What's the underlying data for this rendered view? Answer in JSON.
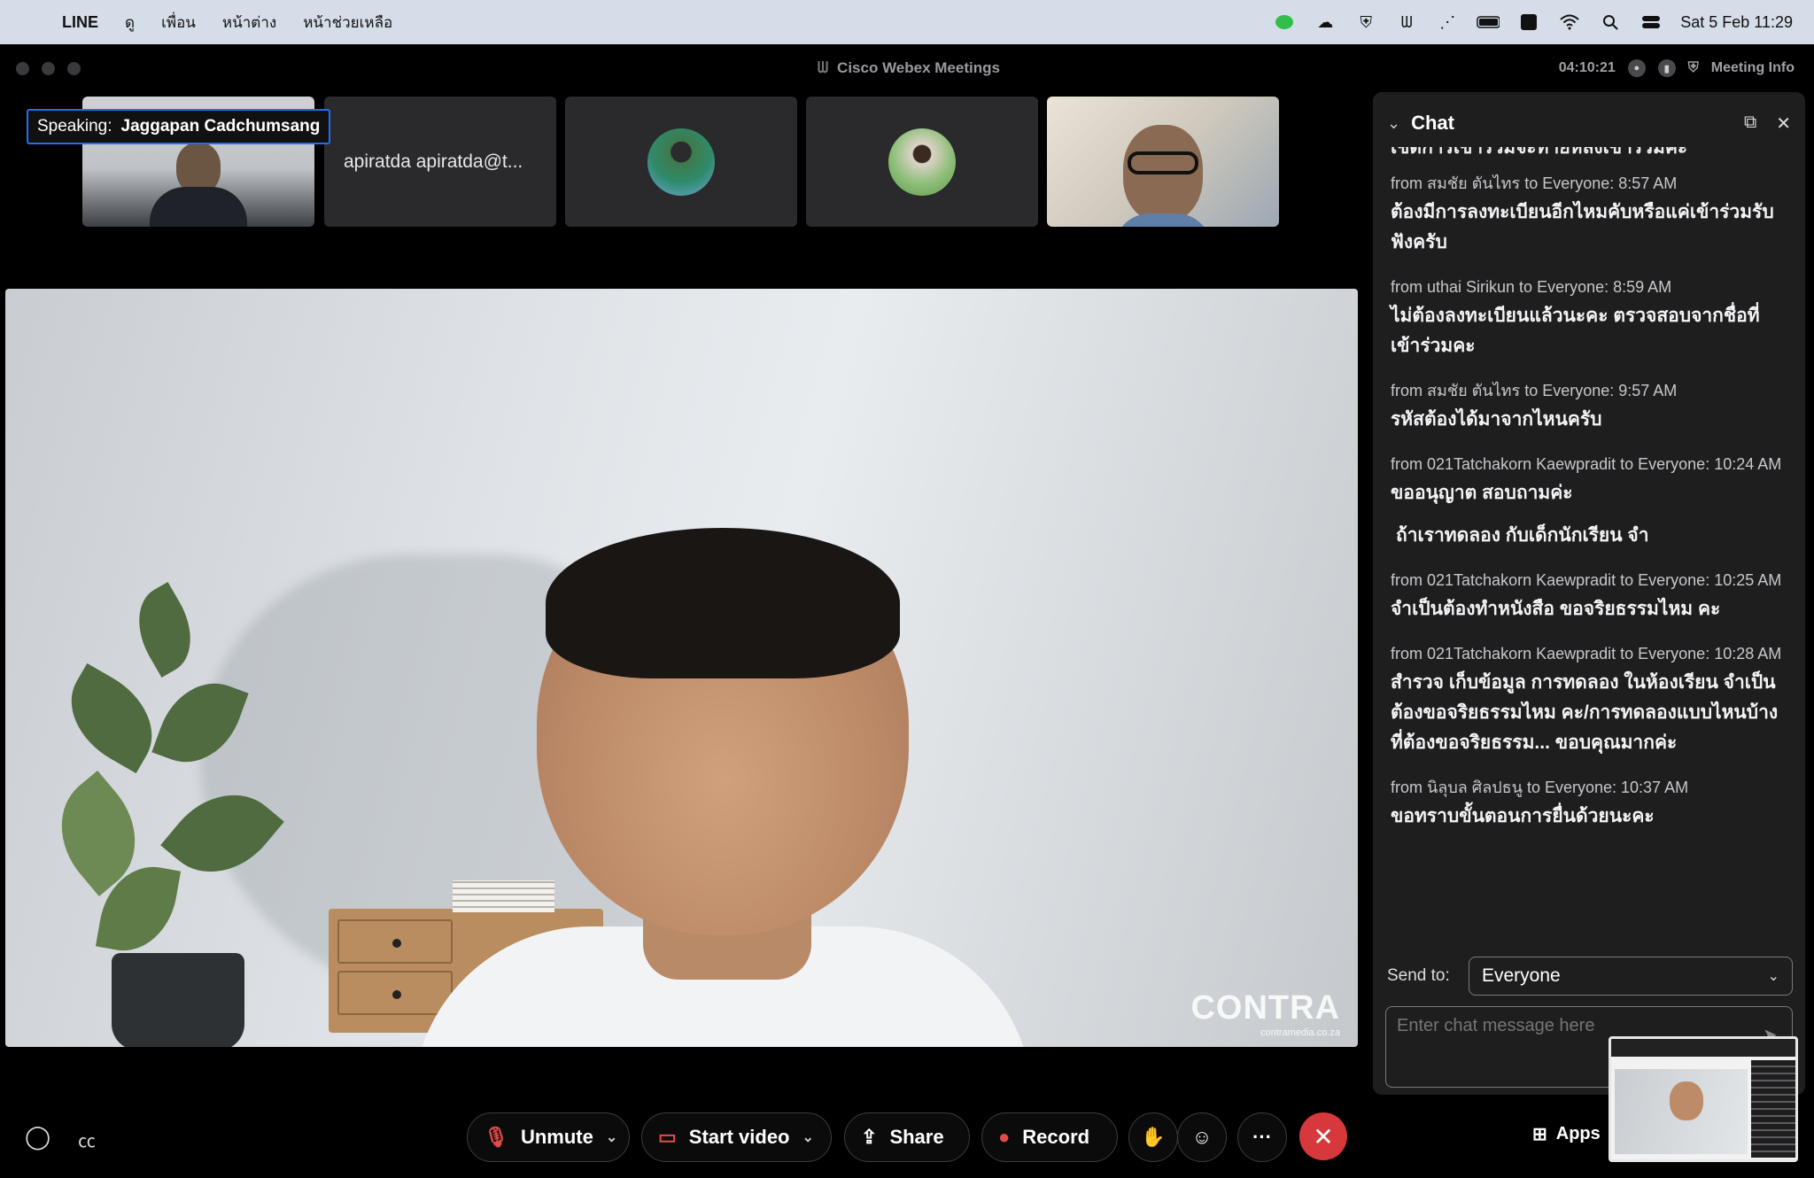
{
  "menubar": {
    "app_name": "LINE",
    "items": [
      "ดู",
      "เพื่อน",
      "หน้าต่าง",
      "หน้าช่วยเหลือ"
    ],
    "clock": "Sat 5 Feb  11:29"
  },
  "window": {
    "title": "Cisco Webex Meetings",
    "timer": "04:10:21",
    "meeting_info": "Meeting Info"
  },
  "speaking": {
    "label": "Speaking:",
    "name": "Jaggapan Cadchumsang"
  },
  "thumbnails": [
    {
      "type": "video"
    },
    {
      "type": "name",
      "name": "apiratda apiratda@t..."
    },
    {
      "type": "avatar"
    },
    {
      "type": "avatar"
    },
    {
      "type": "video"
    }
  ],
  "main_video": {
    "watermark": "CONTRA",
    "watermark_sub": "contramedia.co.za"
  },
  "chat": {
    "title": "Chat",
    "cut_line": "เชิดการเข้าร่วมจะทายหลังเข้าร่วมค่ะ",
    "messages": [
      {
        "meta": "from สมชัย ตันไทร to Everyone:   8:57  AM",
        "body": "ต้องมีการลงทะเบียนอีกไหมคับหรือแค่เข้าร่วมรับฟังครับ"
      },
      {
        "meta": "from uthai Sirikun to Everyone:   8:59  AM",
        "body": "ไม่ต้องลงทะเบียนแล้วนะคะ  ตรวจสอบจากชื่อที่เข้าร่วมคะ"
      },
      {
        "meta": "from สมชัย ตันไทร to Everyone:   9:57  AM",
        "body": "รหัสต้องได้มาจากไหนครับ"
      },
      {
        "meta": "from 021Tatchakorn Kaewpradit to Everyone: 10:24  AM",
        "body": "ขออนุญาต สอบถามค่ะ",
        "body2": "ถ้าเราทดลอง กับเด็กนักเรียน จำ"
      },
      {
        "meta": "from 021Tatchakorn Kaewpradit to Everyone: 10:25  AM",
        "body": "จำเป็นต้องทำหนังสือ ขอจริยธรรมไหม คะ"
      },
      {
        "meta": "from 021Tatchakorn Kaewpradit to Everyone: 10:28  AM",
        "body": "สำรวจ เก็บข้อมูล การทดลอง ในห้องเรียน จำเป็นต้องขอจริยธรรมไหม คะ/การทดลองแบบไหนบ้างที่ต้องขอจริยธรรม...  ขอบคุณมากค่ะ"
      },
      {
        "meta": "from นิลุบล ศิลปธนู to Everyone:   10:37  AM",
        "body": "ขอทราบขั้นตอนการยื่นด้วยนะคะ"
      }
    ],
    "send_to_label": "Send to:",
    "send_to_value": "Everyone",
    "input_placeholder": "Enter chat message here"
  },
  "controls": {
    "unmute": "Unmute",
    "start_video": "Start video",
    "share": "Share",
    "record": "Record",
    "apps": "Apps"
  }
}
